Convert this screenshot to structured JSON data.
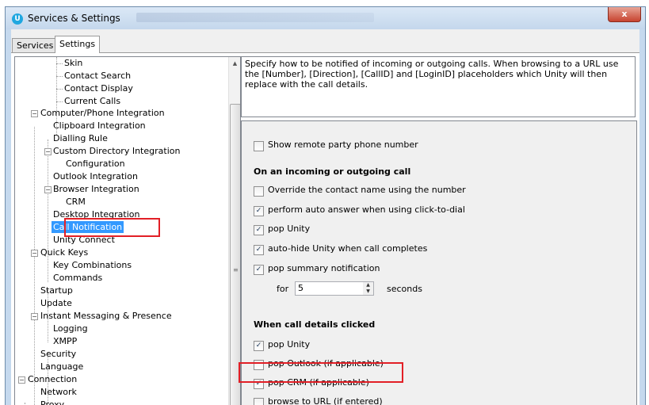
{
  "window": {
    "title": "Services & Settings",
    "app_icon_letter": "U",
    "close_label": "x"
  },
  "tabs": [
    {
      "label": "Services",
      "active": false
    },
    {
      "label": "Settings",
      "active": true
    }
  ],
  "tree": {
    "items": [
      {
        "label": "Skin"
      },
      {
        "label": "Contact Search"
      },
      {
        "label": "Contact Display"
      },
      {
        "label": "Current Calls"
      },
      {
        "label": "Computer/Phone Integration",
        "expanded": true
      },
      {
        "label": "Clipboard Integration"
      },
      {
        "label": "Dialling Rule"
      },
      {
        "label": "Custom Directory Integration",
        "expanded": true
      },
      {
        "label": "Configuration"
      },
      {
        "label": "Outlook Integration"
      },
      {
        "label": "Browser Integration",
        "expanded": true
      },
      {
        "label": "CRM"
      },
      {
        "label": "Desktop Integration"
      },
      {
        "label": "Call Notification",
        "selected": true
      },
      {
        "label": "Unity Connect"
      },
      {
        "label": "Quick Keys",
        "expanded": true
      },
      {
        "label": "Key Combinations"
      },
      {
        "label": "Commands"
      },
      {
        "label": "Startup"
      },
      {
        "label": "Update"
      },
      {
        "label": "Instant Messaging & Presence",
        "expanded": true
      },
      {
        "label": "Logging"
      },
      {
        "label": "XMPP"
      },
      {
        "label": "Security"
      },
      {
        "label": "Language"
      },
      {
        "label": "Connection",
        "expanded": true
      },
      {
        "label": "Network"
      },
      {
        "label": "Proxy"
      }
    ]
  },
  "description": "Specify how to be notified of incoming or outgoing calls.  When browsing to a URL use the [Number], [Direction], [CallID] and [LoginID] placeholders which Unity will then replace with the call details.",
  "settings": {
    "show_remote": {
      "label": "Show remote party phone number",
      "checked": false
    },
    "section_incoming": "On an incoming or outgoing call",
    "override_name": {
      "label": "Override the contact name using the number",
      "checked": false
    },
    "auto_answer": {
      "label": "perform auto answer when using click-to-dial",
      "checked": true
    },
    "pop_unity": {
      "label": "pop Unity",
      "checked": true
    },
    "auto_hide": {
      "label": "auto-hide Unity when call completes",
      "checked": true
    },
    "pop_summary": {
      "label": "pop summary notification",
      "checked": true
    },
    "for_label": "for",
    "seconds_value": "5",
    "seconds_label": "seconds",
    "section_clicked": "When call details clicked",
    "click_pop_unity": {
      "label": "pop Unity",
      "checked": true
    },
    "pop_outlook": {
      "label": "pop Outlook (if applicable)",
      "checked": false
    },
    "pop_crm": {
      "label": "pop CRM (if applicable)",
      "checked": true
    },
    "browse_url": {
      "label": "browse to URL (if entered)",
      "checked": false
    }
  },
  "colors": {
    "highlight_box": "#e21f26",
    "selection": "#3399ff"
  }
}
